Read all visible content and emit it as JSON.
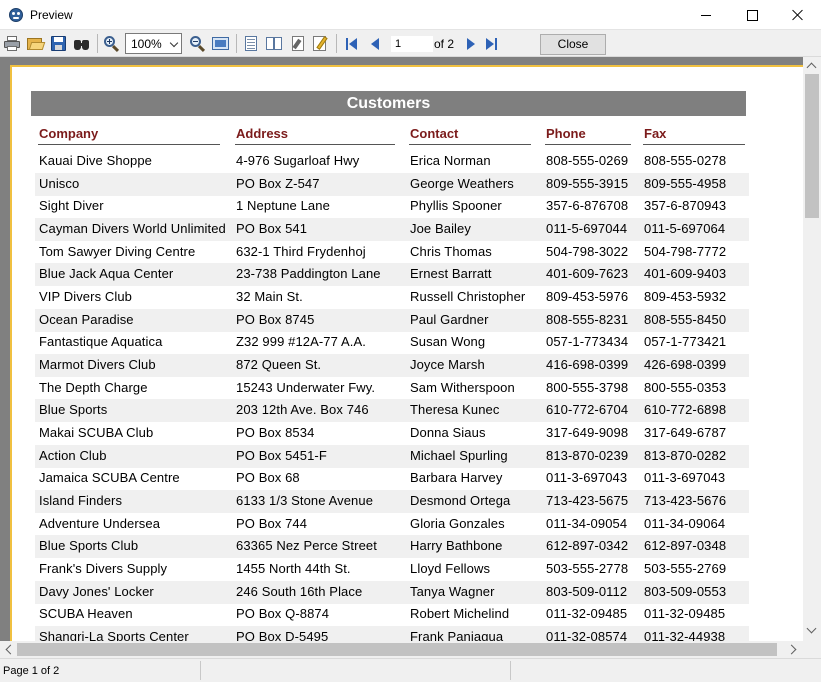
{
  "window": {
    "title": "Preview"
  },
  "toolbar": {
    "zoom_value": "100%",
    "page_value": "1",
    "page_of": "of 2",
    "close_label": "Close"
  },
  "report": {
    "title": "Customers",
    "columns": [
      "Company",
      "Address",
      "Contact",
      "Phone",
      "Fax"
    ],
    "rows": [
      [
        "Kauai Dive Shoppe",
        "4-976 Sugarloaf Hwy",
        "Erica Norman",
        "808-555-0269",
        "808-555-0278"
      ],
      [
        "Unisco",
        "PO Box Z-547",
        "George Weathers",
        "809-555-3915",
        "809-555-4958"
      ],
      [
        "Sight Diver",
        "1 Neptune Lane",
        "Phyllis Spooner",
        "357-6-876708",
        "357-6-870943"
      ],
      [
        "Cayman Divers World Unlimited",
        "PO Box 541",
        "Joe Bailey",
        "011-5-697044",
        "011-5-697064"
      ],
      [
        "Tom Sawyer Diving Centre",
        "632-1 Third Frydenhoj",
        "Chris Thomas",
        "504-798-3022",
        "504-798-7772"
      ],
      [
        "Blue Jack Aqua Center",
        "23-738 Paddington Lane",
        "Ernest Barratt",
        "401-609-7623",
        "401-609-9403"
      ],
      [
        "VIP Divers Club",
        "32 Main St.",
        "Russell Christopher",
        "809-453-5976",
        "809-453-5932"
      ],
      [
        "Ocean Paradise",
        "PO Box 8745",
        "Paul Gardner",
        "808-555-8231",
        "808-555-8450"
      ],
      [
        "Fantastique Aquatica",
        "Z32 999 #12A-77 A.A.",
        "Susan Wong",
        "057-1-773434",
        "057-1-773421"
      ],
      [
        "Marmot Divers Club",
        "872 Queen St.",
        "Joyce Marsh",
        "416-698-0399",
        "426-698-0399"
      ],
      [
        "The Depth Charge",
        "15243 Underwater Fwy.",
        "Sam Witherspoon",
        "800-555-3798",
        "800-555-0353"
      ],
      [
        "Blue Sports",
        "203 12th Ave. Box 746",
        "Theresa Kunec",
        "610-772-6704",
        "610-772-6898"
      ],
      [
        "Makai SCUBA Club",
        "PO Box 8534",
        "Donna Siaus",
        "317-649-9098",
        "317-649-6787"
      ],
      [
        "Action Club",
        "PO Box 5451-F",
        "Michael Spurling",
        "813-870-0239",
        "813-870-0282"
      ],
      [
        "Jamaica SCUBA Centre",
        "PO Box 68",
        "Barbara Harvey",
        "011-3-697043",
        "011-3-697043"
      ],
      [
        "Island Finders",
        "6133 1/3 Stone Avenue",
        "Desmond Ortega",
        "713-423-5675",
        "713-423-5676"
      ],
      [
        "Adventure Undersea",
        "PO Box 744",
        "Gloria Gonzales",
        "011-34-09054",
        "011-34-09064"
      ],
      [
        "Blue Sports Club",
        "63365 Nez Perce Street",
        "Harry Bathbone",
        "612-897-0342",
        "612-897-0348"
      ],
      [
        "Frank's Divers Supply",
        "1455 North 44th St.",
        "Lloyd Fellows",
        "503-555-2778",
        "503-555-2769"
      ],
      [
        "Davy Jones' Locker",
        "246 South 16th Place",
        "Tanya Wagner",
        "803-509-0112",
        "803-509-0553"
      ],
      [
        "SCUBA Heaven",
        "PO Box Q-8874",
        "Robert Michelind",
        "011-32-09485",
        "011-32-09485"
      ],
      [
        "Shangri-La Sports Center",
        "PO Box D-5495",
        "Frank Paniagua",
        "011-32-08574",
        "011-32-44938"
      ]
    ]
  },
  "status": {
    "page_text": "Page 1 of 2"
  }
}
